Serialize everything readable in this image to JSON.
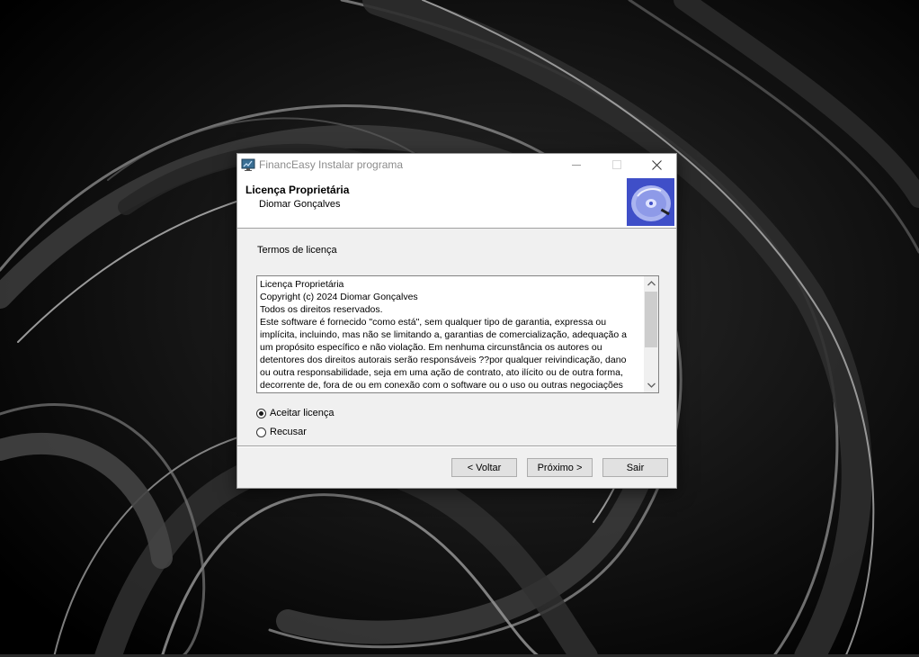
{
  "window": {
    "title": "FinancEasy Instalar programa",
    "icon": "monitor-chart-icon"
  },
  "header": {
    "title": "Licença Proprietária",
    "subtitle": "Diomar Gonçalves",
    "image": "cd-disc-icon"
  },
  "terms": {
    "label": "Termos de licença",
    "lines": [
      " Licença Proprietária",
      "Copyright (c) 2024 Diomar Gonçalves",
      "Todos os direitos reservados.",
      "Este software é fornecido \"como está\", sem qualquer tipo de garantia, expressa ou",
      "implícita, incluindo, mas não se limitando a, garantias de comercialização, adequação a",
      "um propósito específico e não violação. Em nenhuma circunstância os autores ou",
      "detentores dos direitos autorais serão responsáveis ??por qualquer reivindicação, dano",
      "ou outra responsabilidade, seja em uma ação de contrato, ato ilícito ou de outra forma,",
      "decorrente de, fora de ou em conexão com o software ou o uso ou outras negociações"
    ]
  },
  "options": {
    "accept": "Aceitar licença",
    "refuse": "Recusar",
    "selected": "accept"
  },
  "buttons": {
    "back": "< Voltar",
    "next": "Próximo >",
    "exit": "Sair"
  },
  "colors": {
    "dialog_bg": "#f0f0f0",
    "button_bg": "#e1e1e1",
    "disc_blue": "#5566dd"
  }
}
